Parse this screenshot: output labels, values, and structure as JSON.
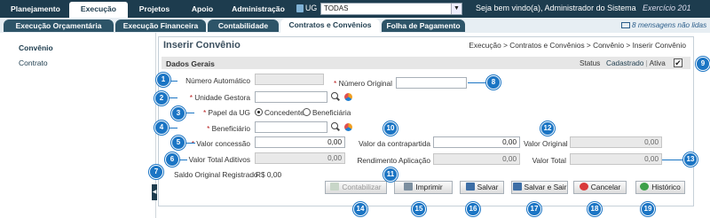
{
  "topbar": {
    "tabs": [
      "Planejamento",
      "Execução",
      "Projetos",
      "Apoio",
      "Administração"
    ],
    "ug_label": "UG",
    "ug_value": "TODAS",
    "welcome": "Seja bem vindo(a), Administrador do Sistema",
    "exercicio": "Exercício 201"
  },
  "subbar": {
    "tabs": [
      "Execução Orçamentária",
      "Execução Financeira",
      "Contabilidade",
      "Contratos e Convênios",
      "Folha de Pagamento"
    ],
    "messages": "8 mensagens não lidas"
  },
  "sidebar": {
    "items": [
      "Convênio",
      "Contrato"
    ]
  },
  "main": {
    "title": "Inserir Convênio",
    "breadcrumb": "Execução > Contratos e Convênios > Convênio > Inserir Convênio",
    "section": "Dados Gerais",
    "status_label": "Status",
    "status_value": "Cadastrado",
    "ativa_label": "Ativa",
    "ativa_check": "✔"
  },
  "form": {
    "numero_automatico": "Número Automático",
    "numero_original": "Número Original",
    "unidade_gestora": "Unidade Gestora",
    "papel_ug": "Papel da UG",
    "opt_concedente": "Concedente",
    "opt_beneficiaria": "Beneficiária",
    "beneficiario": "Beneficiário",
    "valor_concessao": "Valor concessão",
    "valor_concessao_val": "0,00",
    "valor_contrapartida": "Valor da contrapartida",
    "valor_contrapartida_val": "0,00",
    "valor_original": "Valor Original",
    "valor_original_val": "0,00",
    "valor_total_aditivos": "Valor Total Aditivos",
    "valor_total_aditivos_val": "0,00",
    "rendimento_aplicacao": "Rendimento Aplicação",
    "rendimento_aplicacao_val": "0,00",
    "valor_total": "Valor Total",
    "valor_total_val": "0,00",
    "saldo_original": "Saldo Original Registrado",
    "saldo_original_val": "R$ 0,00",
    "req": "*"
  },
  "buttons": [
    "Contabilizar",
    "Imprimir",
    "Salvar",
    "Salvar e Sair",
    "Cancelar",
    "Histórico"
  ],
  "badges": [
    "1",
    "2",
    "3",
    "4",
    "5",
    "6",
    "7",
    "8",
    "9",
    "10",
    "11",
    "12",
    "13",
    "14",
    "15",
    "16",
    "17",
    "18",
    "19"
  ]
}
